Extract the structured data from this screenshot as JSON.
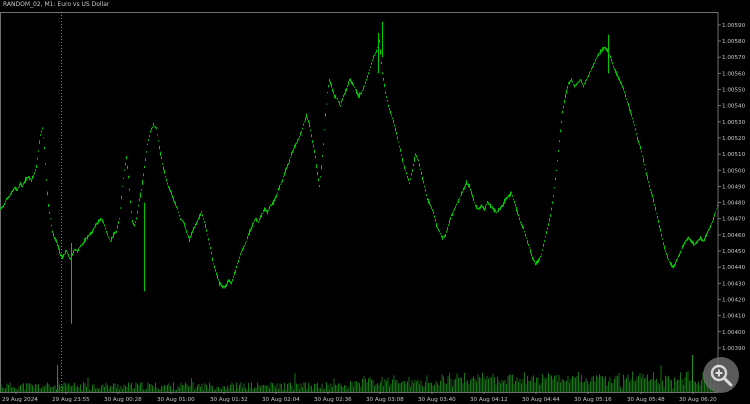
{
  "window": {
    "title": "RANDOM_02, M1:  Euro vs US Dollar"
  },
  "colors": {
    "background": "#000000",
    "candle": "#00c800",
    "volume": "#1f8f1f",
    "axis": "#8c8c8c",
    "text": "#c8c8c8",
    "period_separator": "#9a9a9a"
  },
  "icons": {
    "zoom": "zoom-icon"
  },
  "chart_data": {
    "type": "line",
    "title": "RANDOM_02, M1:  Euro vs US Dollar",
    "grid": false,
    "price_axis_ticks": [
      "1.00590",
      "1.00580",
      "1.00570",
      "1.00560",
      "1.00550",
      "1.00540",
      "1.00530",
      "1.00520",
      "1.00510",
      "1.00500",
      "1.00490",
      "1.00480",
      "1.00470",
      "1.00460",
      "1.00450",
      "1.00440",
      "1.00430",
      "1.00420",
      "1.00410",
      "1.00400",
      "1.00390"
    ],
    "time_axis_ticks": [
      "29 Aug 2024",
      "29 Aug 23:55",
      "30 Aug 00:28",
      "30 Aug 01:00",
      "30 Aug 01:32",
      "30 Aug 02:04",
      "30 Aug 02:36",
      "30 Aug 03:08",
      "30 Aug 03:40",
      "30 Aug 04:12",
      "30 Aug 04:44",
      "30 Aug 05:16",
      "30 Aug 05:48",
      "30 Aug 06:20"
    ],
    "ylim": [
      1.00385,
      1.00598
    ],
    "period_separator_label": "29 Aug 23:55",
    "series": [
      {
        "points": [
          [
            0,
            1.00476
          ],
          [
            3,
            1.00478
          ],
          [
            6,
            1.00482
          ],
          [
            9,
            1.00484
          ],
          [
            11,
            1.00486
          ],
          [
            14,
            1.00489
          ],
          [
            17,
            1.00488
          ],
          [
            20,
            1.00492
          ],
          [
            22,
            1.0049
          ],
          [
            25,
            1.00494
          ],
          [
            28,
            1.00496
          ],
          [
            31,
            1.00494
          ],
          [
            34,
            1.00498
          ],
          [
            36,
            1.00502
          ],
          [
            38,
            1.00512
          ],
          [
            40,
            1.00522
          ],
          [
            42,
            1.00526
          ],
          [
            44,
            1.00514
          ],
          [
            46,
            1.00494
          ],
          [
            48,
            1.00478
          ],
          [
            50,
            1.0047
          ],
          [
            52,
            1.00462
          ],
          [
            54,
            1.00458
          ],
          [
            56,
            1.00456
          ],
          [
            58,
            1.00452
          ],
          [
            60,
            1.00448
          ],
          [
            62,
            1.00446
          ],
          [
            64,
            1.00448
          ],
          [
            66,
            1.0045
          ],
          [
            68,
            1.00447
          ],
          [
            70,
            1.00445
          ],
          [
            72,
            1.00448
          ],
          [
            74,
            1.00451
          ],
          [
            77,
            1.0045
          ],
          [
            80,
            1.00453
          ],
          [
            83,
            1.00455
          ],
          [
            86,
            1.00458
          ],
          [
            89,
            1.0046
          ],
          [
            92,
            1.00462
          ],
          [
            95,
            1.00466
          ],
          [
            98,
            1.00468
          ],
          [
            101,
            1.0047
          ],
          [
            104,
            1.00466
          ],
          [
            107,
            1.0046
          ],
          [
            110,
            1.00456
          ],
          [
            113,
            1.0046
          ],
          [
            116,
            1.00462
          ],
          [
            119,
            1.0047
          ],
          [
            122,
            1.0049
          ],
          [
            124,
            1.005
          ],
          [
            126,
            1.00508
          ],
          [
            128,
            1.00496
          ],
          [
            130,
            1.0048
          ],
          [
            132,
            1.00468
          ],
          [
            134,
            1.00466
          ],
          [
            136,
            1.0047
          ],
          [
            138,
            1.00478
          ],
          [
            141,
            1.00488
          ],
          [
            144,
            1.00502
          ],
          [
            147,
            1.00516
          ],
          [
            150,
            1.00524
          ],
          [
            153,
            1.00528
          ],
          [
            156,
            1.00526
          ],
          [
            159,
            1.00514
          ],
          [
            162,
            1.00504
          ],
          [
            165,
            1.00496
          ],
          [
            168,
            1.0049
          ],
          [
            171,
            1.00486
          ],
          [
            174,
            1.0048
          ],
          [
            177,
            1.00476
          ],
          [
            180,
            1.0047
          ],
          [
            183,
            1.00468
          ],
          [
            186,
            1.00462
          ],
          [
            189,
            1.00457
          ],
          [
            192,
            1.00462
          ],
          [
            195,
            1.00466
          ],
          [
            198,
            1.0047
          ],
          [
            201,
            1.00474
          ],
          [
            204,
            1.00468
          ],
          [
            207,
            1.0046
          ],
          [
            210,
            1.00452
          ],
          [
            213,
            1.00442
          ],
          [
            216,
            1.00436
          ],
          [
            219,
            1.0043
          ],
          [
            222,
            1.00428
          ],
          [
            225,
            1.00428
          ],
          [
            228,
            1.00432
          ],
          [
            231,
            1.0043
          ],
          [
            234,
            1.00436
          ],
          [
            237,
            1.00442
          ],
          [
            240,
            1.00448
          ],
          [
            243,
            1.00452
          ],
          [
            246,
            1.00456
          ],
          [
            249,
            1.00462
          ],
          [
            252,
            1.00466
          ],
          [
            255,
            1.0047
          ],
          [
            258,
            1.00468
          ],
          [
            261,
            1.00472
          ],
          [
            264,
            1.00476
          ],
          [
            267,
            1.00474
          ],
          [
            270,
            1.00478
          ],
          [
            273,
            1.0048
          ],
          [
            276,
            1.00484
          ],
          [
            279,
            1.0049
          ],
          [
            282,
            1.00494
          ],
          [
            285,
            1.005
          ],
          [
            288,
            1.00504
          ],
          [
            291,
            1.0051
          ],
          [
            294,
            1.00514
          ],
          [
            297,
            1.00518
          ],
          [
            300,
            1.00522
          ],
          [
            303,
            1.00528
          ],
          [
            306,
            1.00534
          ],
          [
            309,
            1.00528
          ],
          [
            312,
            1.00518
          ],
          [
            315,
            1.00508
          ],
          [
            317,
            1.00498
          ],
          [
            319,
            1.0049
          ],
          [
            321,
            1.00502
          ],
          [
            323,
            1.00516
          ],
          [
            325,
            1.00534
          ],
          [
            327,
            1.00548
          ],
          [
            329,
            1.00556
          ],
          [
            331,
            1.00552
          ],
          [
            334,
            1.00546
          ],
          [
            337,
            1.00544
          ],
          [
            340,
            1.0054
          ],
          [
            343,
            1.00546
          ],
          [
            346,
            1.0055
          ],
          [
            349,
            1.00556
          ],
          [
            352,
            1.00554
          ],
          [
            355,
            1.0055
          ],
          [
            358,
            1.00546
          ],
          [
            361,
            1.00548
          ],
          [
            364,
            1.00552
          ],
          [
            367,
            1.00558
          ],
          [
            370,
            1.00564
          ],
          [
            373,
            1.0057
          ],
          [
            376,
            1.00574
          ],
          [
            379,
            1.0058
          ],
          [
            382,
            1.0056
          ],
          [
            385,
            1.00548
          ],
          [
            388,
            1.0054
          ],
          [
            391,
            1.00534
          ],
          [
            394,
            1.00528
          ],
          [
            397,
            1.0052
          ],
          [
            400,
            1.00512
          ],
          [
            403,
            1.00504
          ],
          [
            406,
            1.00498
          ],
          [
            409,
            1.00492
          ],
          [
            412,
            1.005
          ],
          [
            415,
            1.0051
          ],
          [
            418,
            1.00506
          ],
          [
            421,
            1.00498
          ],
          [
            424,
            1.0049
          ],
          [
            427,
            1.00482
          ],
          [
            430,
            1.00478
          ],
          [
            433,
            1.00474
          ],
          [
            436,
            1.00466
          ],
          [
            439,
            1.00462
          ],
          [
            442,
            1.00458
          ],
          [
            445,
            1.0046
          ],
          [
            448,
            1.00466
          ],
          [
            451,
            1.00472
          ],
          [
            454,
            1.00476
          ],
          [
            457,
            1.0048
          ],
          [
            460,
            1.00484
          ],
          [
            463,
            1.00488
          ],
          [
            466,
            1.00492
          ],
          [
            469,
            1.0049
          ],
          [
            472,
            1.00484
          ],
          [
            475,
            1.00478
          ],
          [
            478,
            1.00476
          ],
          [
            481,
            1.00478
          ],
          [
            484,
            1.00476
          ],
          [
            487,
            1.0048
          ],
          [
            490,
            1.00478
          ],
          [
            493,
            1.00476
          ],
          [
            496,
            1.00474
          ],
          [
            499,
            1.00476
          ],
          [
            502,
            1.00478
          ],
          [
            505,
            1.00482
          ],
          [
            508,
            1.00484
          ],
          [
            511,
            1.00486
          ],
          [
            514,
            1.0048
          ],
          [
            517,
            1.00474
          ],
          [
            520,
            1.00468
          ],
          [
            523,
            1.00464
          ],
          [
            526,
            1.00458
          ],
          [
            529,
            1.00452
          ],
          [
            532,
            1.00446
          ],
          [
            535,
            1.00442
          ],
          [
            538,
            1.00444
          ],
          [
            541,
            1.00448
          ],
          [
            544,
            1.00456
          ],
          [
            547,
            1.00464
          ],
          [
            550,
            1.00472
          ],
          [
            553,
            1.00484
          ],
          [
            556,
            1.005
          ],
          [
            559,
            1.00518
          ],
          [
            562,
            1.00536
          ],
          [
            565,
            1.00546
          ],
          [
            568,
            1.00554
          ],
          [
            571,
            1.00556
          ],
          [
            574,
            1.00552
          ],
          [
            577,
            1.00554
          ],
          [
            580,
            1.00556
          ],
          [
            583,
            1.00552
          ],
          [
            586,
            1.00556
          ],
          [
            589,
            1.0056
          ],
          [
            592,
            1.00564
          ],
          [
            595,
            1.00568
          ],
          [
            598,
            1.00572
          ],
          [
            601,
            1.00574
          ],
          [
            604,
            1.00576
          ],
          [
            607,
            1.00574
          ],
          [
            610,
            1.0057
          ],
          [
            613,
            1.00564
          ],
          [
            616,
            1.0056
          ],
          [
            619,
            1.00556
          ],
          [
            622,
            1.00552
          ],
          [
            625,
            1.00546
          ],
          [
            628,
            1.0054
          ],
          [
            631,
            1.00534
          ],
          [
            634,
            1.00528
          ],
          [
            637,
            1.0052
          ],
          [
            640,
            1.00514
          ],
          [
            643,
            1.00506
          ],
          [
            646,
            1.00498
          ],
          [
            649,
            1.0049
          ],
          [
            652,
            1.00484
          ],
          [
            655,
            1.00476
          ],
          [
            658,
            1.00468
          ],
          [
            661,
            1.0046
          ],
          [
            664,
            1.00452
          ],
          [
            667,
            1.00446
          ],
          [
            670,
            1.00442
          ],
          [
            673,
            1.0044
          ],
          [
            676,
            1.00444
          ],
          [
            679,
            1.00448
          ],
          [
            682,
            1.00452
          ],
          [
            685,
            1.00456
          ],
          [
            688,
            1.00458
          ],
          [
            691,
            1.00456
          ],
          [
            694,
            1.00454
          ],
          [
            697,
            1.00456
          ],
          [
            700,
            1.00458
          ],
          [
            703,
            1.00456
          ],
          [
            706,
            1.0046
          ],
          [
            709,
            1.00464
          ],
          [
            712,
            1.00468
          ],
          [
            715,
            1.00474
          ],
          [
            718,
            1.0048
          ]
        ]
      }
    ]
  }
}
